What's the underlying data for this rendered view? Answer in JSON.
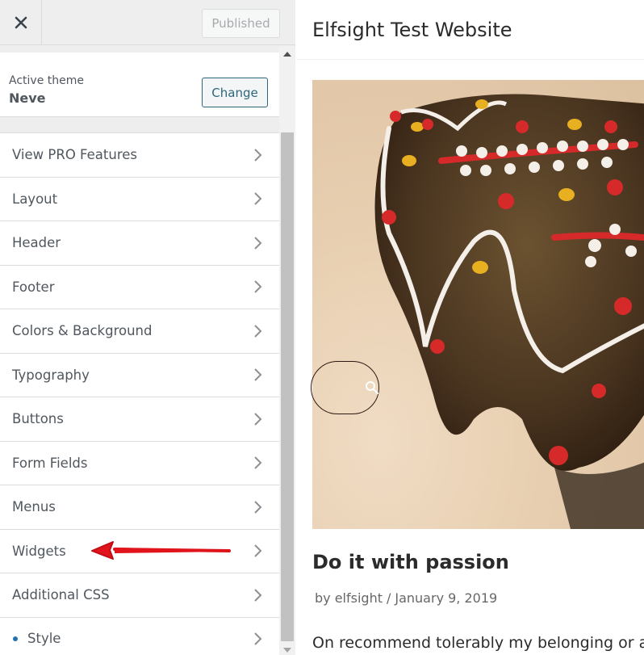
{
  "topbar": {
    "close_icon": "close-icon",
    "publish_label": "Published"
  },
  "theme": {
    "label": "Active theme",
    "name": "Neve",
    "change_label": "Change"
  },
  "menu": {
    "items": [
      {
        "label": "View PRO Features"
      },
      {
        "label": "Layout"
      },
      {
        "label": "Header"
      },
      {
        "label": "Footer"
      },
      {
        "label": "Colors & Background"
      },
      {
        "label": "Typography"
      },
      {
        "label": "Buttons"
      },
      {
        "label": "Form Fields"
      },
      {
        "label": "Menus"
      },
      {
        "label": "Widgets"
      },
      {
        "label": "Additional CSS"
      },
      {
        "label": "Style"
      }
    ]
  },
  "annotation": {
    "arrow_color": "#e0141a",
    "target": "Widgets"
  },
  "preview": {
    "site_title": "Elfsight Test Website",
    "post_title": "Do it with passion",
    "author": "by elfsight",
    "separator": "/",
    "date": "January 9, 2019",
    "excerpt": "On recommend tolerably my belonging or am."
  },
  "colors": {
    "accent": "#2271b1",
    "change_button": "#2c6679"
  }
}
